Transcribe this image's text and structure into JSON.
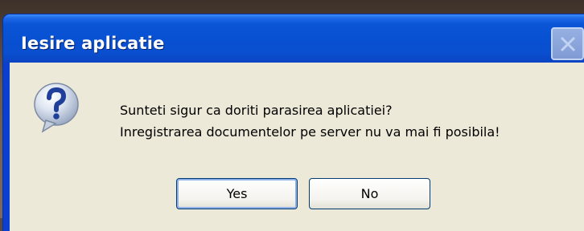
{
  "window": {
    "title": "Iesire aplicatie"
  },
  "message": {
    "line1": "Sunteti sigur ca doriti parasirea aplicatiei?",
    "line2": "Inregistrarea documentelor pe server nu va mai fi posibila!"
  },
  "icon": "question-icon",
  "buttons": {
    "yes_label": "Yes",
    "no_label": "No"
  },
  "colors": {
    "titlebar": "#0751d2",
    "client_background": "#ece9d8",
    "button_border": "#003c74"
  }
}
